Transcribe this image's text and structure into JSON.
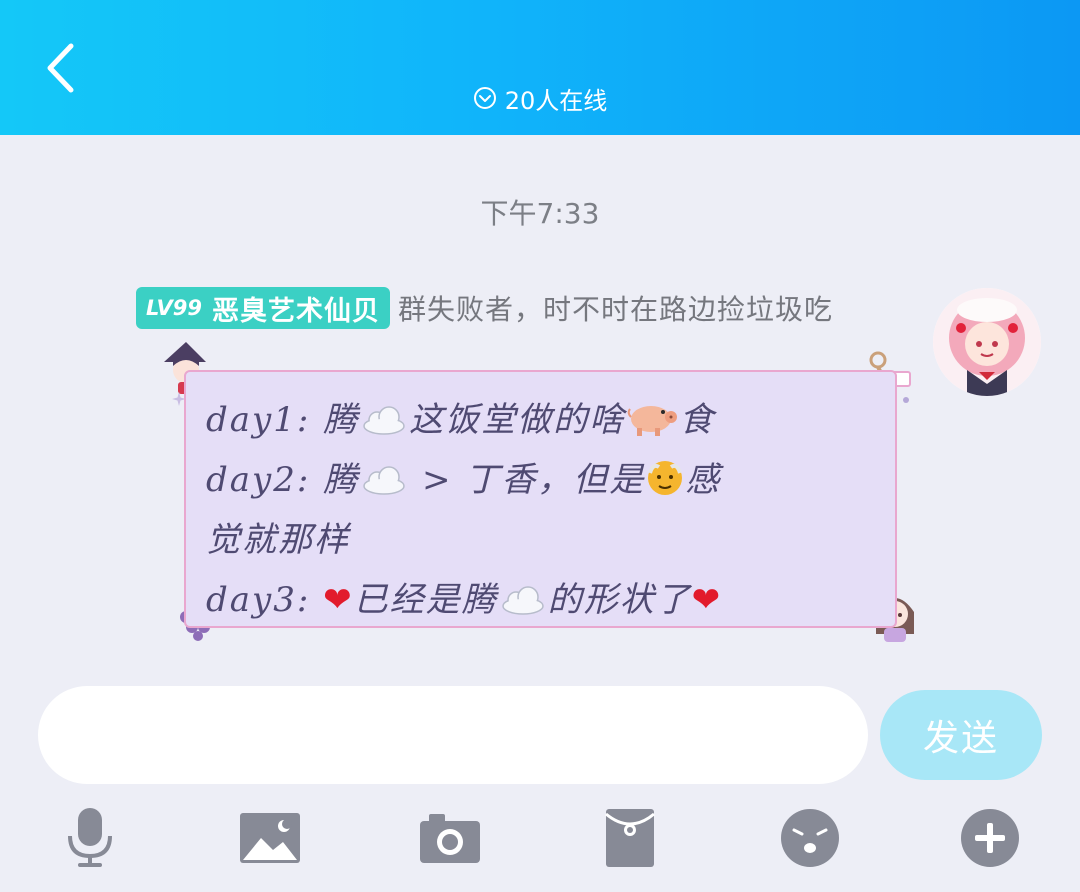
{
  "header": {
    "online_text": "20人在线"
  },
  "chat": {
    "timestamp": "下午7:33",
    "message": {
      "level_badge": "LV99",
      "nickname": "恶臭艺术仙贝",
      "group_title": "群失败者，时不时在路边捡垃圾吃",
      "lines": [
        {
          "pre": "day1:  腾",
          "post": "这饭堂做的啥",
          "end": "食"
        },
        {
          "pre": "day2:  腾",
          "post": " > 丁香，但是",
          "end": "感"
        },
        {
          "pre": "觉就那样"
        },
        {
          "pre": "day3:  ",
          "heart": "❤",
          "mid": "已经是腾",
          "post": "的形状了",
          "heart2": "❤"
        }
      ]
    }
  },
  "composer": {
    "input_value": "",
    "send_label": "发送"
  },
  "toolbar": {
    "icons": [
      "microphone-icon",
      "image-icon",
      "camera-icon",
      "red-packet-icon",
      "emoji-icon",
      "plus-icon"
    ]
  },
  "colors": {
    "header_start": "#14c8f8",
    "header_end": "#0c98f4",
    "badge": "#3bd0c4",
    "bubble": "#e5def7",
    "send_button": "#a8e7f7",
    "toolbar_icon": "#878a96"
  }
}
